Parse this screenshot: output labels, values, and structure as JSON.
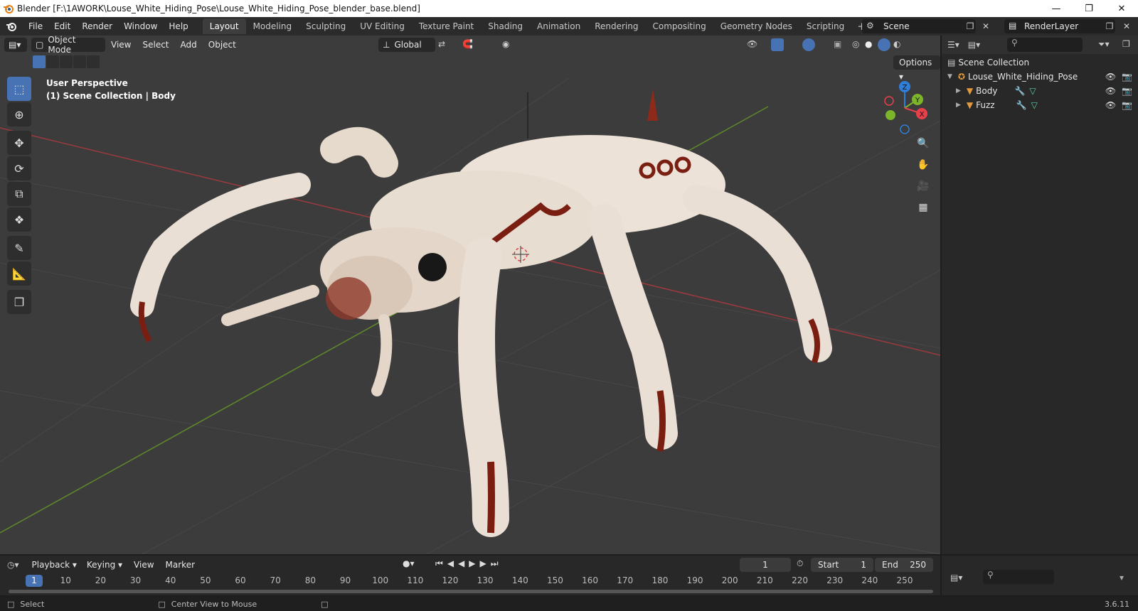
{
  "window": {
    "title": "Blender [F:\\1AWORK\\Louse_White_Hiding_Pose\\Louse_White_Hiding_Pose_blender_base.blend]"
  },
  "menu": [
    "File",
    "Edit",
    "Render",
    "Window",
    "Help"
  ],
  "workspaces": [
    "Layout",
    "Modeling",
    "Sculpting",
    "UV Editing",
    "Texture Paint",
    "Shading",
    "Animation",
    "Rendering",
    "Compositing",
    "Geometry Nodes",
    "Scripting"
  ],
  "active_workspace": "Layout",
  "scene": {
    "name": "Scene"
  },
  "render_layer": {
    "name": "RenderLayer"
  },
  "viewport": {
    "mode": "Object Mode",
    "menus": [
      "View",
      "Select",
      "Add",
      "Object"
    ],
    "transform_orientation": "Global",
    "options_label": "Options",
    "info_line1": "User Perspective",
    "info_line2": "(1) Scene Collection | Body"
  },
  "gizmo": {
    "x": "X",
    "y": "Y",
    "z": "Z"
  },
  "outliner": {
    "root": "Scene Collection",
    "items": [
      {
        "label": "Louse_White_Hiding_Pose",
        "level": 1
      },
      {
        "label": "Body",
        "level": 2
      },
      {
        "label": "Fuzz",
        "level": 2
      }
    ]
  },
  "timeline": {
    "menus": [
      "Playback",
      "Keying",
      "View",
      "Marker"
    ],
    "current_frame": "1",
    "start_label": "Start",
    "start": "1",
    "end_label": "End",
    "end": "250",
    "ticks": [
      "1",
      "10",
      "20",
      "30",
      "40",
      "50",
      "60",
      "70",
      "80",
      "90",
      "100",
      "110",
      "120",
      "130",
      "140",
      "150",
      "160",
      "170",
      "180",
      "190",
      "200",
      "210",
      "220",
      "230",
      "240",
      "250"
    ]
  },
  "statusbar": {
    "select": "Select",
    "center_view": "Center View to Mouse",
    "version": "3.6.11"
  },
  "colors": {
    "accent": "#4772b3",
    "x_axis": "#e8404a",
    "y_axis": "#7cb42a",
    "z_axis": "#2f7fd9",
    "object_orange": "#e39a3c"
  }
}
